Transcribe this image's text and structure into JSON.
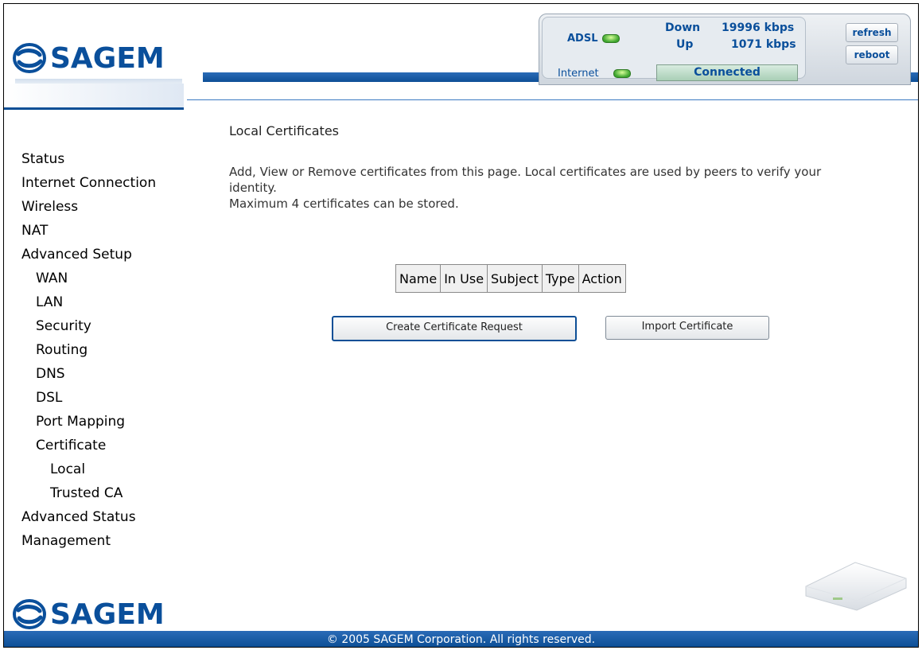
{
  "brand": {
    "name": "SAGEM"
  },
  "status": {
    "adsl_label": "ADSL",
    "internet_label": "Internet",
    "down_label": "Down",
    "down_value": "19996 kbps",
    "up_label": "Up",
    "up_value": "1071 kbps",
    "connection_state": "Connected",
    "refresh_label": "refresh",
    "reboot_label": "reboot"
  },
  "sidebar": {
    "items": [
      {
        "label": "Status"
      },
      {
        "label": "Internet Connection"
      },
      {
        "label": "Wireless"
      },
      {
        "label": "NAT"
      },
      {
        "label": "Advanced Setup"
      },
      {
        "label": "WAN"
      },
      {
        "label": "LAN"
      },
      {
        "label": "Security"
      },
      {
        "label": "Routing"
      },
      {
        "label": "DNS"
      },
      {
        "label": "DSL"
      },
      {
        "label": "Port Mapping"
      },
      {
        "label": "Certificate"
      },
      {
        "label": "Local"
      },
      {
        "label": "Trusted CA"
      },
      {
        "label": "Advanced Status"
      },
      {
        "label": "Management"
      }
    ]
  },
  "main": {
    "title": "Local Certificates",
    "description_line1": "Add, View or Remove certificates from this page. Local certificates are used by peers to verify your identity.",
    "description_line2": "Maximum 4 certificates can be stored.",
    "table": {
      "headers": [
        "Name",
        "In Use",
        "Subject",
        "Type",
        "Action"
      ]
    },
    "create_button_label": "Create Certificate Request",
    "import_button_label": "Import Certificate"
  },
  "footer": {
    "copyright": "© 2005 SAGEM Corporation. All rights reserved."
  },
  "colors": {
    "brand_blue": "#0a4f9b",
    "led_green": "#3da52e"
  }
}
